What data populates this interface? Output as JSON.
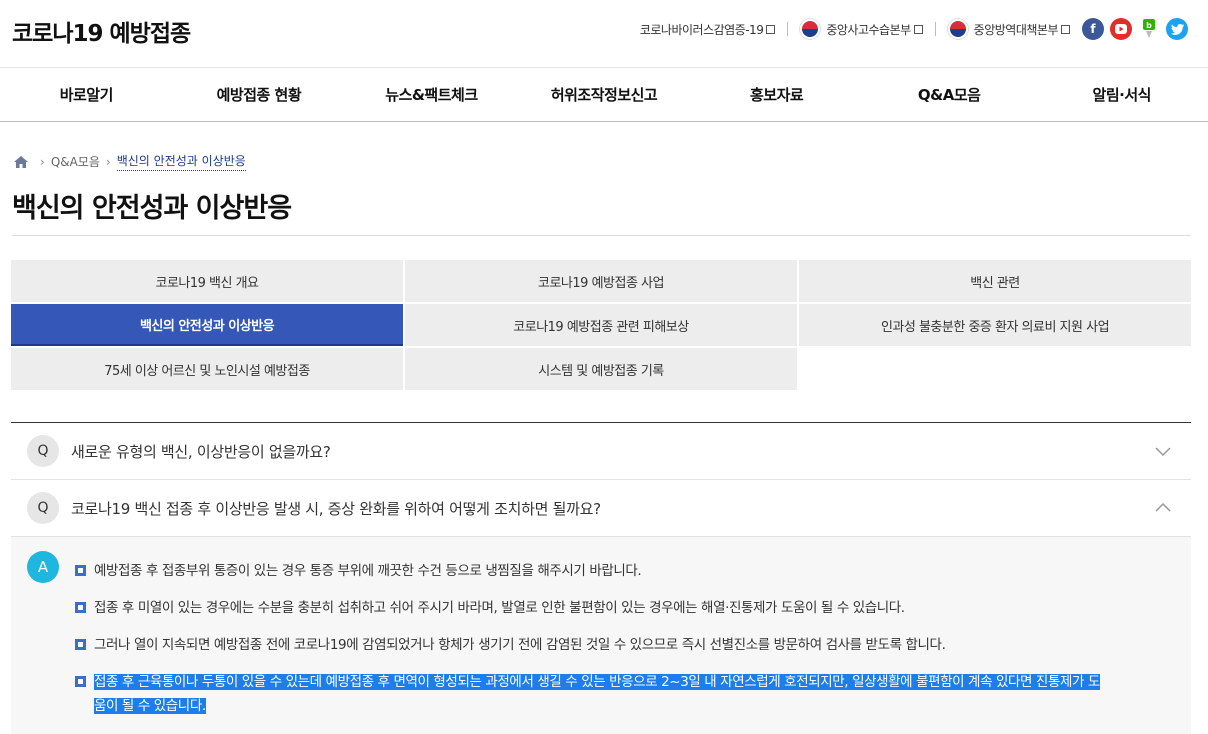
{
  "header": {
    "site_title": "코로나19 예방접종",
    "links": [
      {
        "label": "코로나바이러스감염증-19"
      },
      {
        "label": "중앙사고수습본부"
      },
      {
        "label": "중앙방역대책본부"
      }
    ],
    "sns": [
      "facebook-icon",
      "youtube-icon",
      "blog-icon",
      "twitter-icon"
    ]
  },
  "nav": {
    "items": [
      "바로알기",
      "예방접종 현황",
      "뉴스&팩트체크",
      "허위조작정보신고",
      "홍보자료",
      "Q&A모음",
      "알림·서식"
    ]
  },
  "breadcrumb": {
    "items": [
      "Q&A모음"
    ],
    "current": "백신의 안전성과 이상반응"
  },
  "page": {
    "title": "백신의 안전성과 이상반응"
  },
  "tabs": [
    {
      "label": "코로나19 백신 개요",
      "active": false
    },
    {
      "label": "코로나19 예방접종 사업",
      "active": false
    },
    {
      "label": "백신 관련",
      "active": false
    },
    {
      "label": "백신의 안전성과 이상반응",
      "active": true
    },
    {
      "label": "코로나19 예방접종 관련 피해보상",
      "active": false
    },
    {
      "label": "인과성 불충분한 중증 환자 의료비 지원 사업",
      "active": false
    },
    {
      "label": "75세 이상 어르신 및 노인시설 예방접종",
      "active": false
    },
    {
      "label": "시스템 및 예방접종 기록",
      "active": false
    }
  ],
  "faq": {
    "q_badge": "Q",
    "a_badge": "A",
    "questions": [
      {
        "text": "새로운 유형의 백신, 이상반응이 없을까요?",
        "expanded": false
      },
      {
        "text": "코로나19 백신 접종 후 이상반응 발생 시, 증상 완화를 위하여 어떻게 조치하면 될까요?",
        "expanded": true
      }
    ],
    "answer_items": [
      "예방접종 후 접종부위 통증이 있는 경우 통증 부위에 깨끗한 수건 등으로 냉찜질을 해주시기 바랍니다.",
      "접종 후 미열이 있는 경우에는 수분을 충분히 섭취하고 쉬어 주시기 바라며, 발열로 인한 불편함이 있는 경우에는 해열·진통제가 도움이 될 수 있습니다.",
      "그러나 열이 지속되면 예방접종 전에 코로나19에 감염되었거나 항체가 생기기 전에 감염된 것일 수 있으므로 즉시 선별진소를 방문하여 검사를 받도록 합니다.",
      "접종 후 근육통이나 두통이 있을 수 있는데 예방접종 후 면역이 형성되는 과정에서 생길 수 있는 반응으로 2~3일 내 자연스럽게 호전되지만, 일상생활에 불편함이 계속 있다면 진통제가 도움이 될 수 있습니다."
    ]
  },
  "colors": {
    "active_tab": "#3457b8",
    "answer_badge": "#1fb6e0",
    "highlight": "#1e7de8"
  }
}
